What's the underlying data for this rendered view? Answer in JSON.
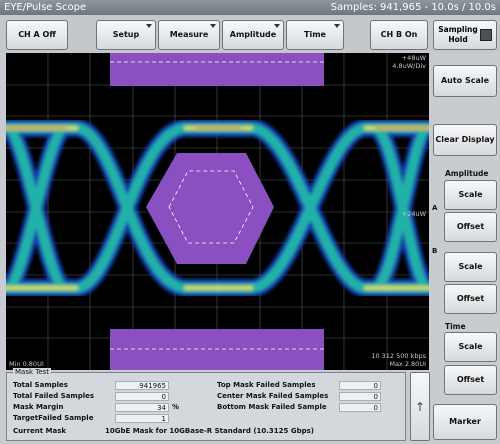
{
  "window": {
    "title": "EYE/Pulse Scope",
    "status": "Samples: 941,965 - 10.0s / 10.0s"
  },
  "toolbar": {
    "ch_a": "CH A Off",
    "setup": "Setup",
    "measure": "Measure",
    "amplitude": "Amplitude",
    "time": "Time",
    "ch_b": "CH B On",
    "sampling_hold": "Sampling Hold"
  },
  "scope": {
    "top_right_1": "+48uW",
    "top_right_2": "4.8uW/Div",
    "mid_right": "+24uW",
    "bottom_left": "Min 0.80UI",
    "bottom_right_1": "10 312 500 kbps",
    "bottom_right_2": "Max 2.80UI"
  },
  "sidebar": {
    "auto_scale": "Auto Scale",
    "clear_display": "Clear Display",
    "amplitude_label": "Amplitude",
    "a_scale": "Scale",
    "a_offset": "Offset",
    "b_scale": "Scale",
    "b_offset": "Offset",
    "time_label": "Time",
    "t_scale": "Scale",
    "t_offset": "Offset",
    "marker": "Marker",
    "channel_a": "A",
    "channel_b": "B"
  },
  "mask_test": {
    "legend": "Mask Test",
    "total_samples_label": "Total Samples",
    "total_samples": "941965",
    "total_failed_label": "Total Failed Samples",
    "total_failed": "0",
    "mask_margin_label": "Mask Margin",
    "mask_margin": "34",
    "mask_margin_unit": "%",
    "target_failed_label": "TargetFailed Sample",
    "target_failed": "1",
    "top_failed_label": "Top Mask Failed Samples",
    "top_failed": "0",
    "center_failed_label": "Center Mask Failed Samples",
    "center_failed": "0",
    "bottom_failed_label": "Bottom Mask Failed Sample",
    "bottom_failed": "0",
    "current_mask_label": "Current Mask",
    "current_mask": "10GbE Mask for 10GBase-R Standard  (10.3125 Gbps)"
  },
  "colors": {
    "mask": "#8a4fc0",
    "trace_hot": "#e8e040",
    "trace_mid": "#20b8a8",
    "trace_cold": "#1848c8"
  },
  "icons": {
    "scroll": "arrow-up-icon"
  }
}
